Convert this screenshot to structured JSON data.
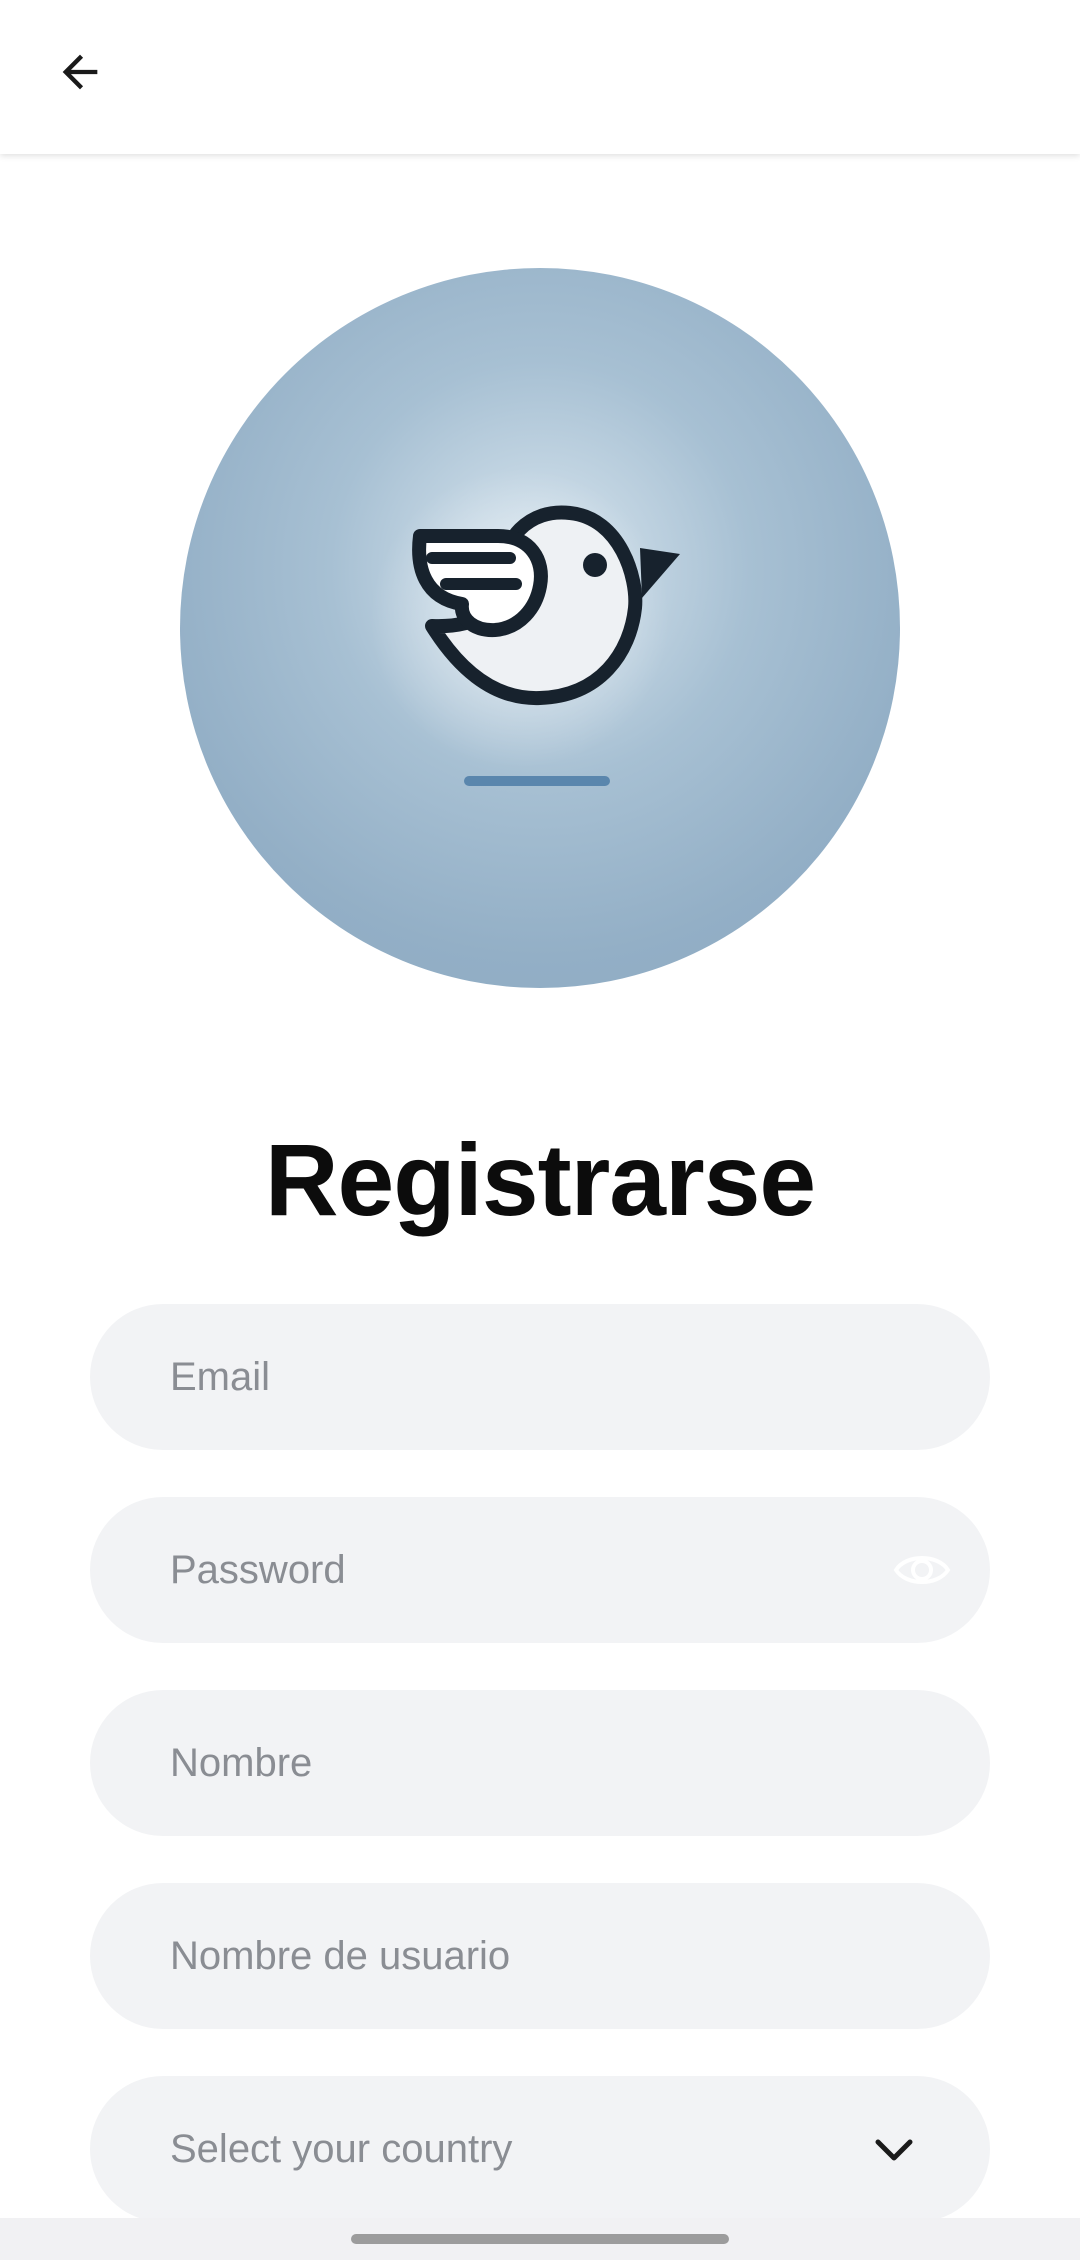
{
  "header": {
    "back_icon": "arrow-back-icon"
  },
  "avatar": {
    "icon": "bird-logo-icon"
  },
  "page": {
    "title": "Registrarse"
  },
  "form": {
    "email_placeholder": "Email",
    "password_placeholder": "Password",
    "password_toggle_icon": "eye-icon",
    "name_placeholder": "Nombre",
    "username_placeholder": "Nombre de usuario",
    "country_placeholder": "Select your country",
    "country_icon": "chevron-down-icon"
  },
  "colors": {
    "field_background": "#f2f3f5",
    "avatar_background": "#9bb6cb",
    "title": "#0c0c0c",
    "placeholder": "#8a8d93"
  }
}
